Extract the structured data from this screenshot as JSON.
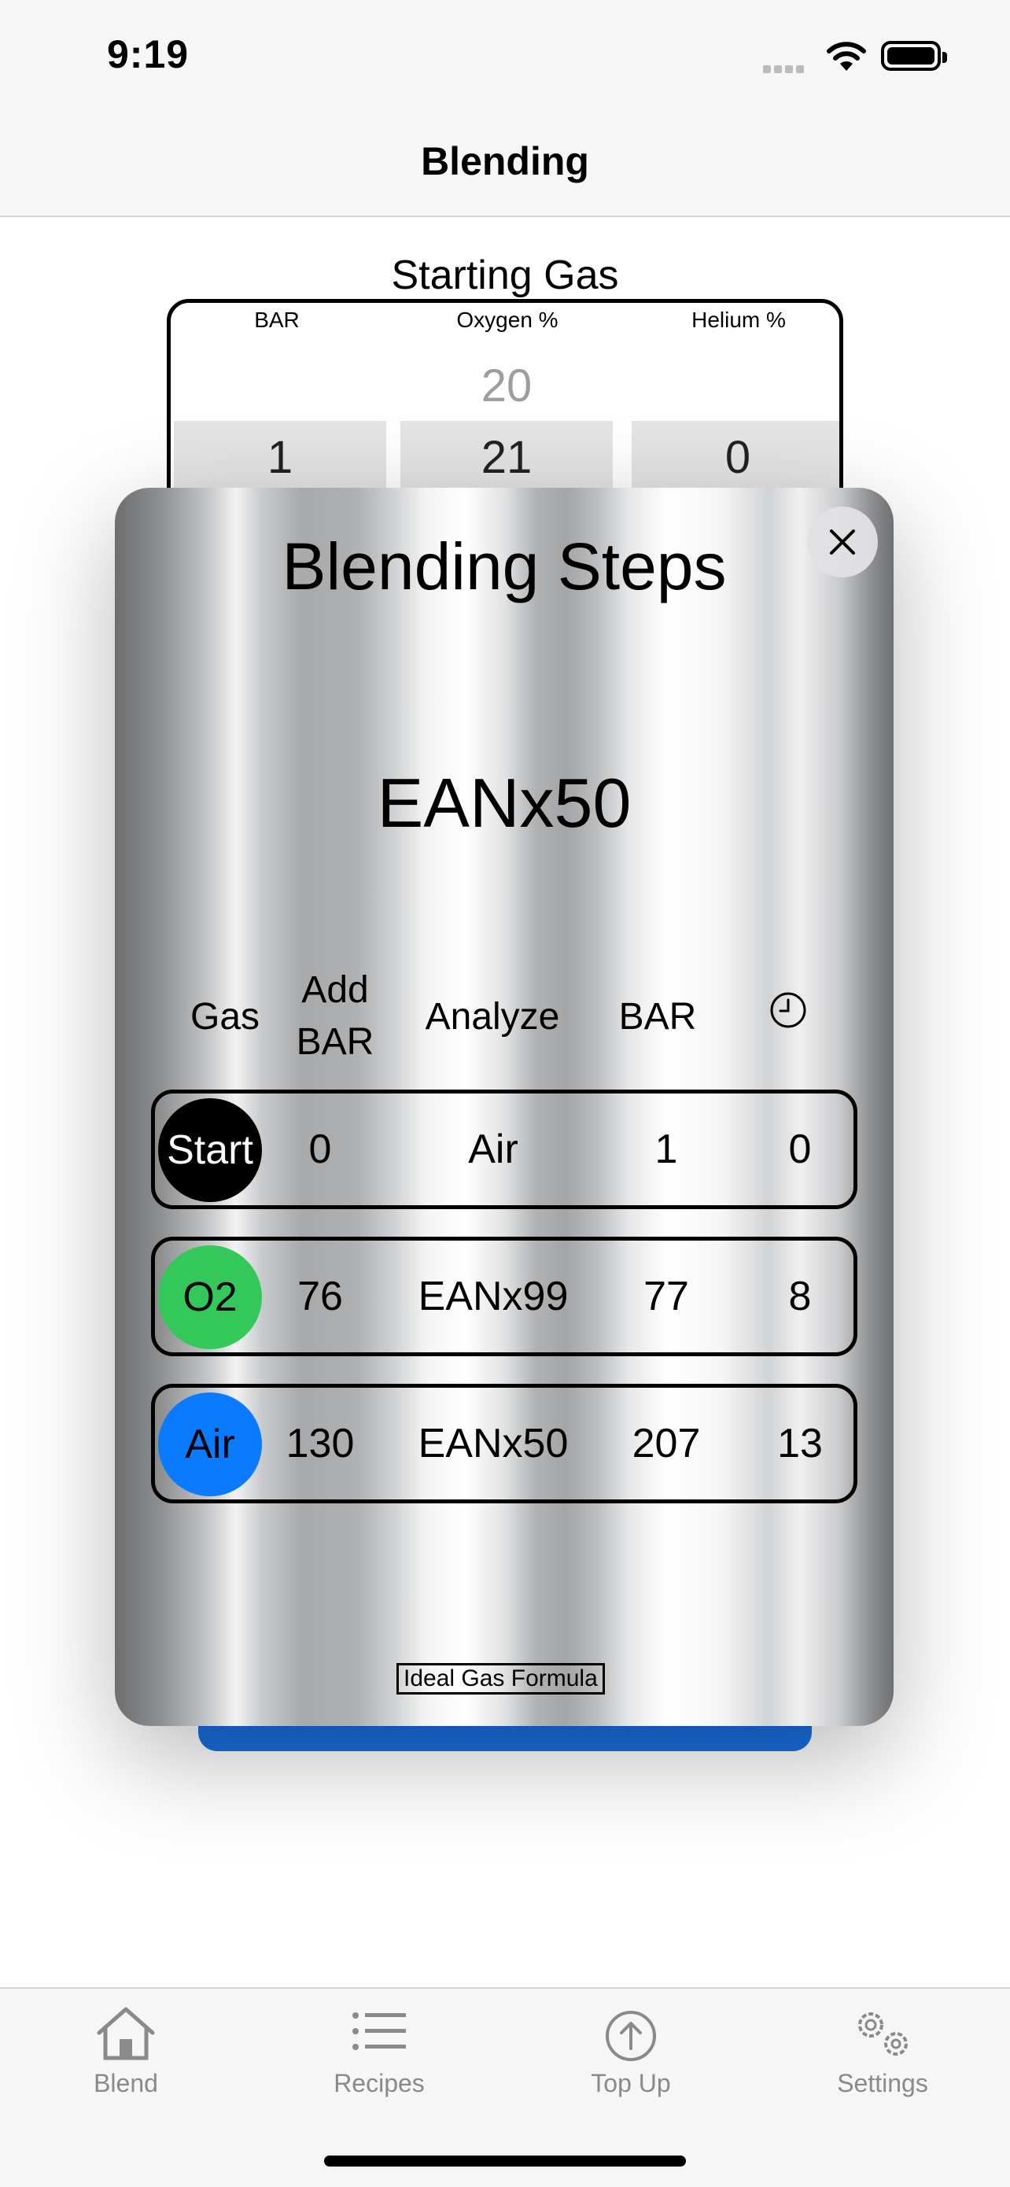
{
  "status_bar": {
    "time": "9:19"
  },
  "nav": {
    "title": "Blending"
  },
  "starting_gas": {
    "label": "Starting Gas",
    "columns": [
      {
        "header": "BAR",
        "above_value": "",
        "selected_value": "1"
      },
      {
        "header": "Oxygen %",
        "above_value": "20",
        "selected_value": "21"
      },
      {
        "header": "Helium %",
        "above_value": "",
        "selected_value": "0"
      }
    ]
  },
  "modal": {
    "title": "Blending Steps",
    "mix_name": "EANx50",
    "close_icon": "close-icon",
    "headers": {
      "gas": "Gas",
      "add_bar_1": "Add",
      "add_bar_2": "BAR",
      "analyze": "Analyze",
      "bar": "BAR",
      "time_icon": "clock-icon"
    },
    "steps": [
      {
        "gas": "Start",
        "gas_color": "#000000",
        "text_color": "#ffffff",
        "add_bar": "0",
        "analyze": "Air",
        "bar": "1",
        "time": "0"
      },
      {
        "gas": "O2",
        "gas_color": "#34c759",
        "text_color": "#000000",
        "add_bar": "76",
        "analyze": "EANx99",
        "bar": "77",
        "time": "8"
      },
      {
        "gas": "Air",
        "gas_color": "#0a7aff",
        "text_color": "#000000",
        "add_bar": "130",
        "analyze": "EANx50",
        "bar": "207",
        "time": "13"
      }
    ],
    "formula_link": "Ideal Gas Formula"
  },
  "tabs": [
    {
      "label": "Blend",
      "icon": "house-icon"
    },
    {
      "label": "Recipes",
      "icon": "list-icon"
    },
    {
      "label": "Top Up",
      "icon": "arrow-up-circle-icon"
    },
    {
      "label": "Settings",
      "icon": "gears-icon"
    }
  ],
  "colors": {
    "accent": "#1a6fe0",
    "tab_inactive": "#8a8a8a"
  }
}
